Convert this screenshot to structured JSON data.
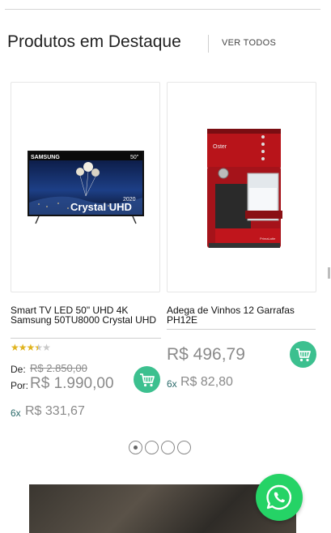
{
  "section": {
    "title": "Produtos em Destaque",
    "see_all": "VER TODOS"
  },
  "products": [
    {
      "name": "Smart TV LED 50\" UHD 4K Samsung 50TU8000 Crystal UHD",
      "image_text": {
        "brand": "SAMSUNG",
        "size": "50\"",
        "year": "2020",
        "tagline": "Crystal UHD"
      },
      "rating": 3.5,
      "old_price_label": "De:",
      "old_price": "R$ 2.850,00",
      "new_price_label": "Por:",
      "new_price": "R$ 1.990,00",
      "installments_count": "6x",
      "installment_value": "R$ 331,67",
      "cart_icon": "shopping-cart-icon"
    },
    {
      "name": "Adega de Vinhos 12 Garrafas PH12E",
      "price": "R$ 496,79",
      "installments_count": "6x",
      "installment_value": "R$ 82,80",
      "cart_icon": "shopping-cart-icon"
    }
  ],
  "carousel": {
    "pages": 4,
    "active": 1
  },
  "whatsapp": {
    "icon": "whatsapp-icon"
  },
  "colors": {
    "accent_green": "#3cc08f",
    "whatsapp_green": "#25d366",
    "price_gray": "#8a8a8a",
    "star": "#e0b420"
  }
}
